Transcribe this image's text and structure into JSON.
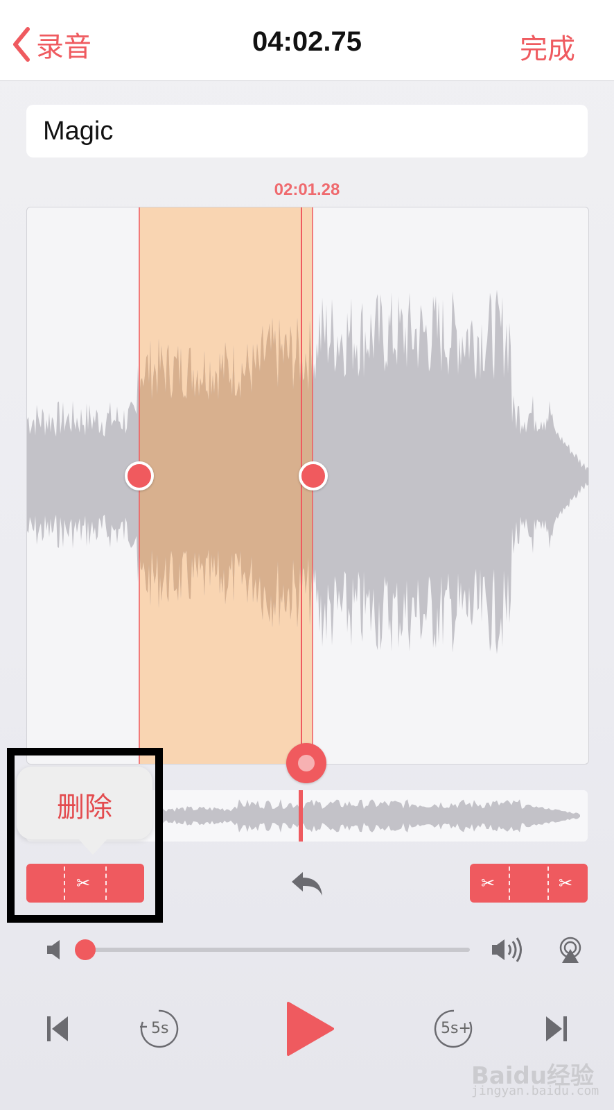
{
  "nav": {
    "back_label": "录音",
    "title": "04:02.75",
    "done_label": "完成"
  },
  "recording": {
    "name": "Magic"
  },
  "editor": {
    "current_time": "02:01.28"
  },
  "context_menu": {
    "delete_label": "删除"
  },
  "playback": {
    "volume_level": 0.0,
    "skip_back_label": "5s",
    "skip_forward_label": "5s+"
  },
  "watermark": {
    "brand": "Baidu经验",
    "url": "jingyan.baidu.com"
  },
  "colors": {
    "accent": "#ef5a5f",
    "selection": "#f8d6b4",
    "waveform": "#c3c2c8"
  }
}
